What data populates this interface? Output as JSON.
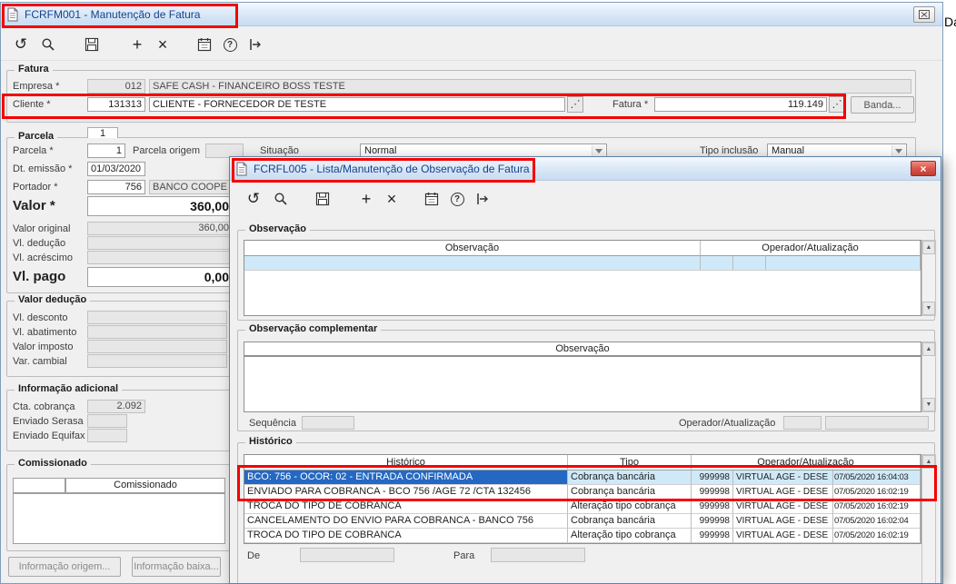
{
  "screen": {
    "partial_text_right": "Da"
  },
  "icons": {
    "undo": "↺",
    "add": "+",
    "delete": "×",
    "help": "?",
    "lookup": "⋰",
    "scroll_up": "▲",
    "scroll_down": "▼",
    "close": "×"
  },
  "main_window": {
    "title": "FCRFM001 - Manutenção de Fatura",
    "fatura": {
      "group_label": "Fatura",
      "empresa_label": "Empresa *",
      "empresa_code": "012",
      "empresa_name": "SAFE CASH - FINANCEIRO BOSS TESTE",
      "cliente_label": "Cliente *",
      "cliente_code": "131313",
      "cliente_name": "CLIENTE - FORNECEDOR DE TESTE",
      "fatura_label": "Fatura *",
      "fatura_value": "119.149",
      "banda_button": "Banda..."
    },
    "parcela": {
      "group_label": "Parcela",
      "tab_label": "1",
      "parcela_label": "Parcela *",
      "parcela_value": "1",
      "parcela_origem_label": "Parcela origem",
      "parcela_origem_value": "",
      "situacao_label": "Situação",
      "situacao_value": "Normal",
      "tipo_inclusao_label": "Tipo inclusão",
      "tipo_inclusao_value": "Manual",
      "dt_emissao_label": "Dt. emissão *",
      "dt_emissao_value": "01/03/2020",
      "portador_label": "Portador *",
      "portador_code": "756",
      "portador_name": "BANCO COOPE",
      "valor_label": "Valor *",
      "valor_value": "360,00",
      "valor_original_label": "Valor original",
      "valor_original_value": "360,00",
      "vl_deducao_label": "Vl. dedução",
      "vl_deducao_value": "",
      "vl_acrescimo_label": "Vl. acréscimo",
      "vl_acrescimo_value": "",
      "vl_pago_label": "Vl. pago",
      "vl_pago_value": "0,00"
    },
    "valor_deducao": {
      "group_label": "Valor dedução",
      "fields": [
        {
          "label": "Vl. desconto",
          "value": ""
        },
        {
          "label": "Vl. abatimento",
          "value": ""
        },
        {
          "label": "Valor imposto",
          "value": ""
        },
        {
          "label": "Var. cambial",
          "value": ""
        }
      ]
    },
    "info_adicional": {
      "group_label": "Informação adicional",
      "cta_cobranca_label": "Cta. cobrança",
      "cta_cobranca_value": "2.092",
      "enviado_serasa_label": "Enviado Serasa",
      "enviado_serasa_value": "",
      "enviado_equifax_label": "Enviado Equifax",
      "enviado_equifax_value": ""
    },
    "comissionado": {
      "group_label": "Comissionado",
      "column_header": "Comissionado"
    },
    "footer_buttons": {
      "info_origem": "Informação origem...",
      "info_baixa": "Informação baixa..."
    }
  },
  "modal": {
    "title": "FCRFL005 - Lista/Manutenção de Observação de Fatura",
    "observacao": {
      "group_label": "Observação",
      "col_observacao": "Observação",
      "col_operador": "Operador/Atualização"
    },
    "observacao_complementar": {
      "group_label": "Observação complementar",
      "col_observacao": "Observação",
      "sequencia_label": "Sequência",
      "sequencia_value": "",
      "operador_label": "Operador/Atualização"
    },
    "historico": {
      "group_label": "Histórico",
      "col_historico": "Histórico",
      "col_tipo": "Tipo",
      "col_operador": "Operador/Atualização",
      "rows": [
        {
          "historico": "BCO: 756 - OCOR: 02 - ENTRADA CONFIRMADA",
          "tipo": "Cobrança bancária",
          "op_code": "999998",
          "op_name": "VIRTUAL AGE - DESE",
          "datetime": "07/05/2020 16:04:03"
        },
        {
          "historico": "ENVIADO PARA COBRANCA - BCO 756 /AGE 72 /CTA 132456",
          "tipo": "Cobrança bancária",
          "op_code": "999998",
          "op_name": "VIRTUAL AGE - DESE",
          "datetime": "07/05/2020 16:02:19"
        },
        {
          "historico": "TROCA DO TIPO DE COBRANCA",
          "tipo": "Alteração tipo cobrança",
          "op_code": "999998",
          "op_name": "VIRTUAL AGE - DESE",
          "datetime": "07/05/2020 16:02:19"
        },
        {
          "historico": "CANCELAMENTO DO ENVIO PARA COBRANCA - BANCO 756",
          "tipo": "Cobrança bancária",
          "op_code": "999998",
          "op_name": "VIRTUAL AGE - DESE",
          "datetime": "07/05/2020 16:02:04"
        },
        {
          "historico": "TROCA DO TIPO DE COBRANCA",
          "tipo": "Alteração tipo cobrança",
          "op_code": "999998",
          "op_name": "VIRTUAL AGE - DESE",
          "datetime": "07/05/2020 16:02:19"
        }
      ],
      "de_label": "De",
      "para_label": "Para"
    }
  }
}
